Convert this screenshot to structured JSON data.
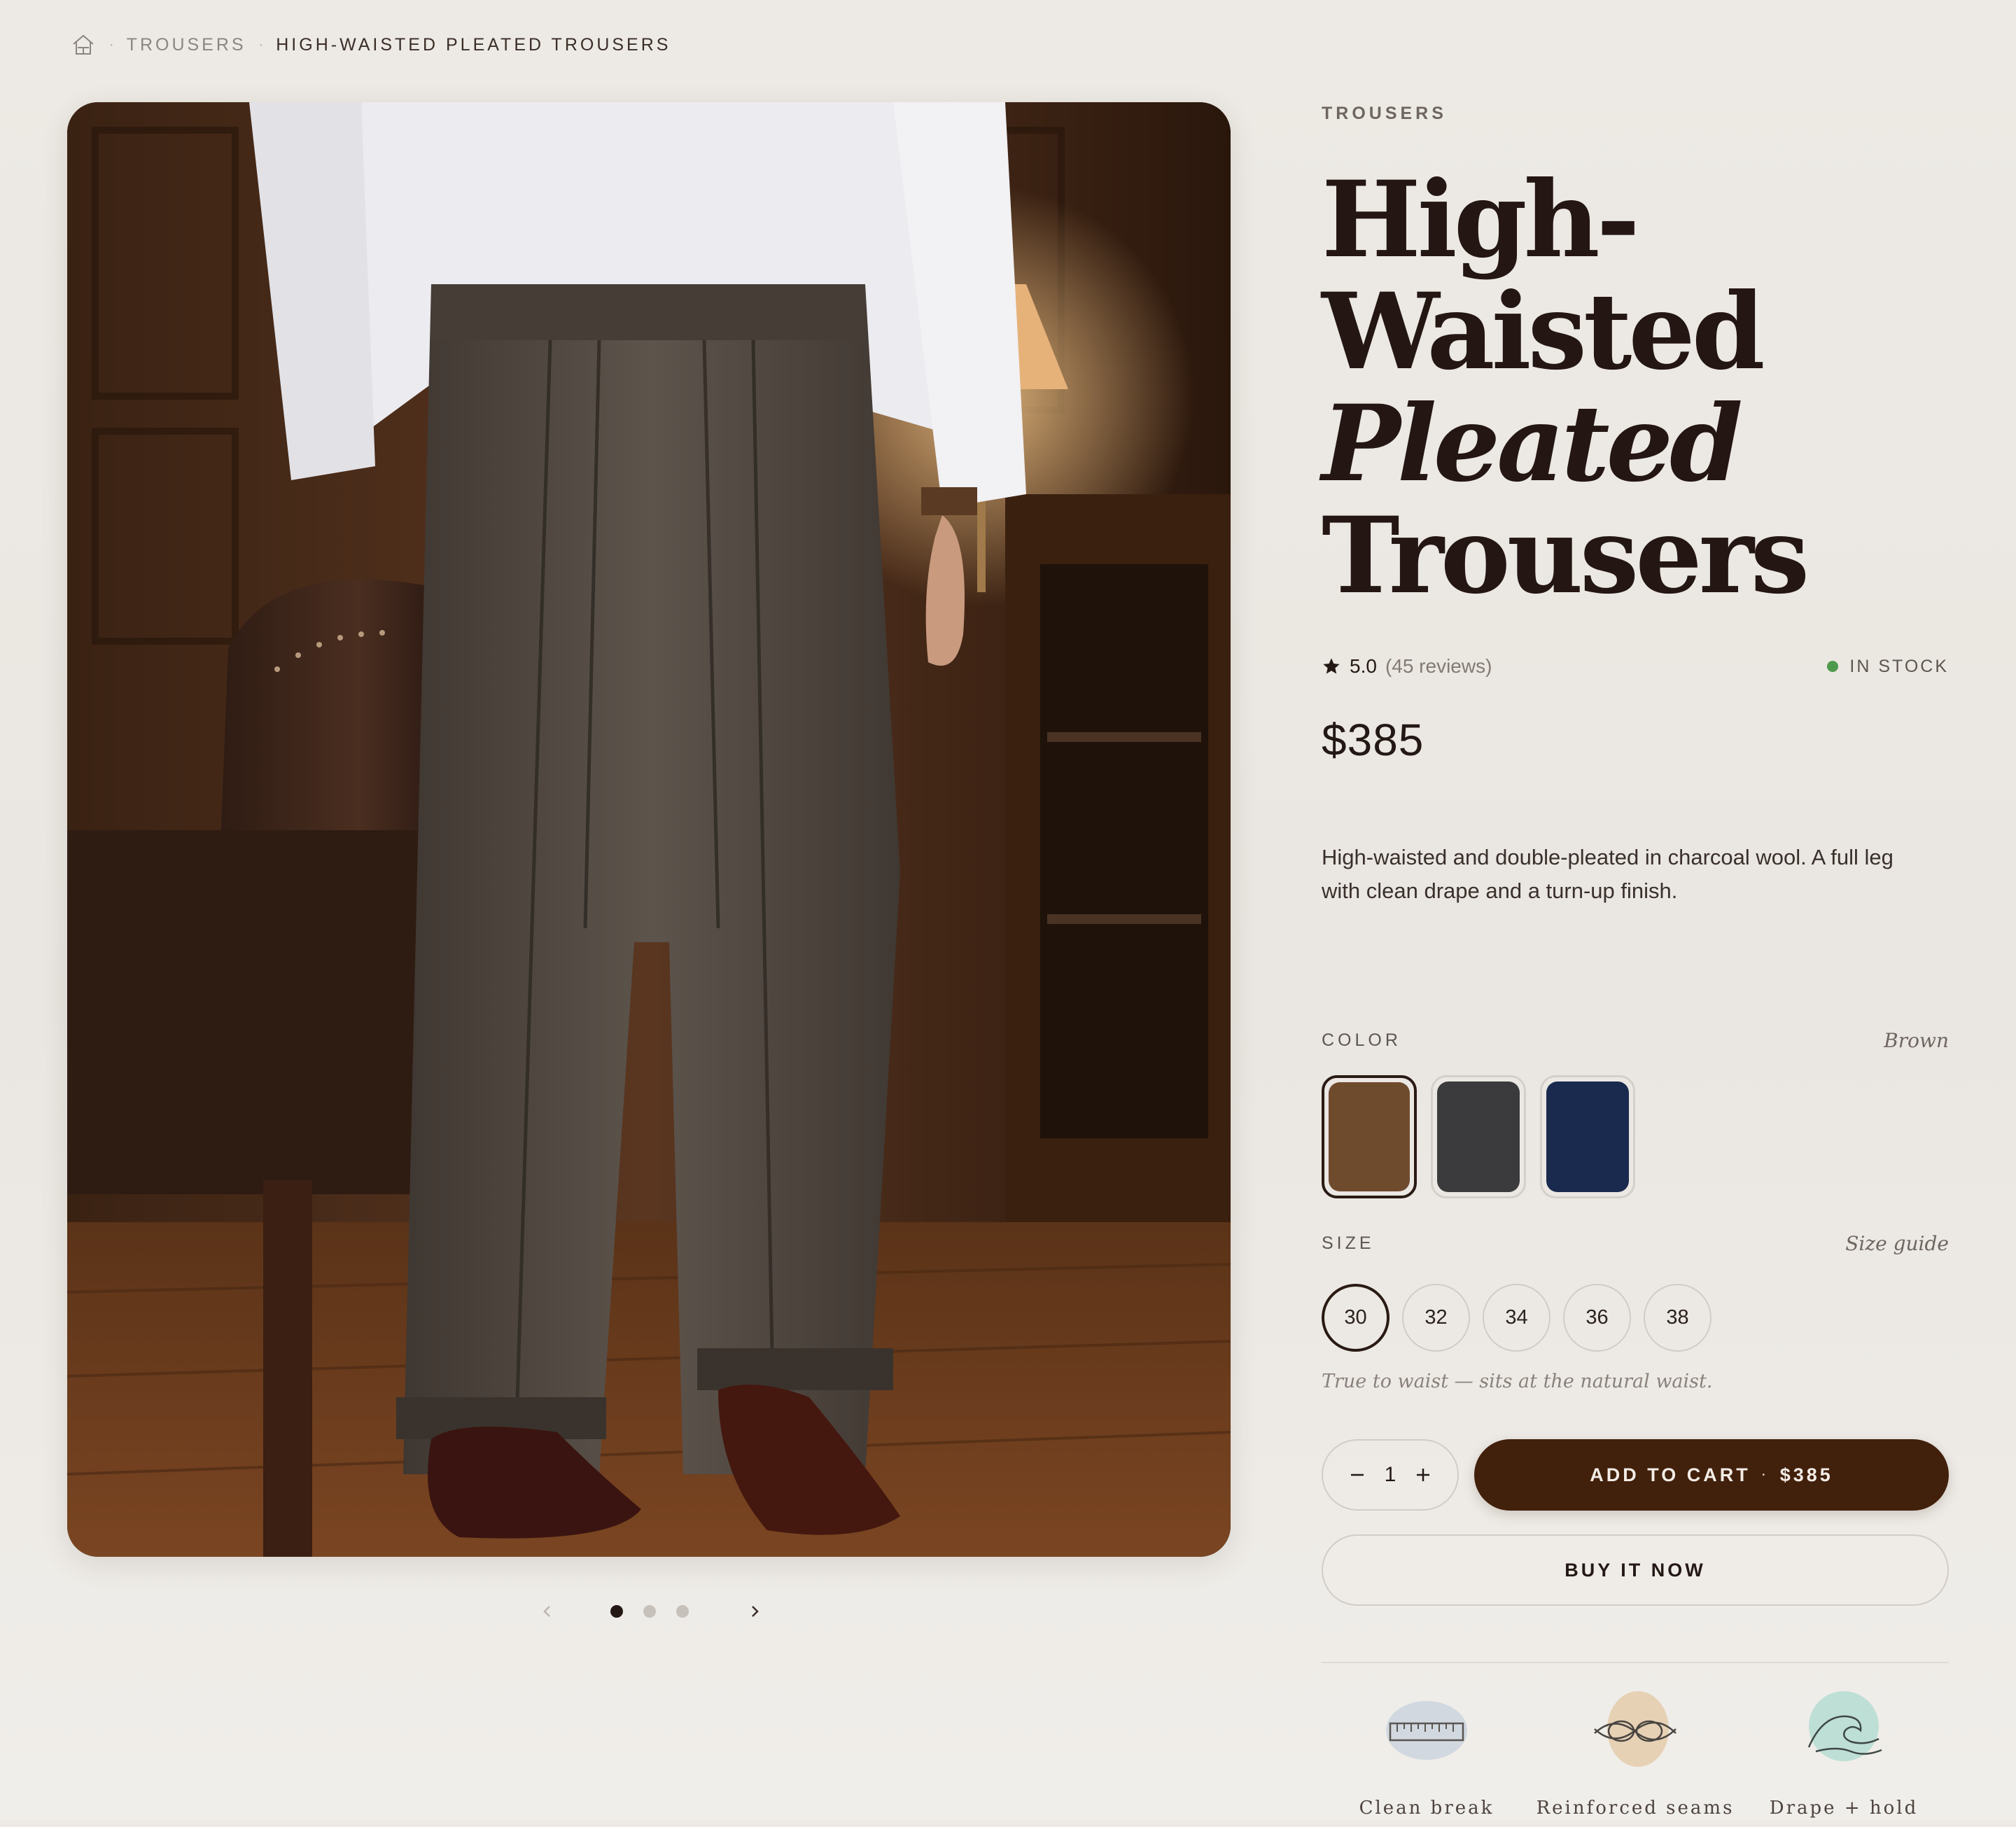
{
  "breadcrumb": {
    "home_icon": "home-icon",
    "separator": "·",
    "category": "TROUSERS",
    "current": "HIGH-WAISTED PLEATED TROUSERS"
  },
  "gallery": {
    "image_alt": "Man wearing high-waisted pleated brown herringbone trousers in a wood-panelled study",
    "slide_count": 3,
    "active_slide": 1,
    "prev_icon": "chevron-left-icon",
    "next_icon": "chevron-right-icon"
  },
  "product": {
    "category": "TROUSERS",
    "title_line1": "High-",
    "title_line2": "Waisted",
    "title_line3": "Pleated",
    "title_line4": "Trousers",
    "rating": "5.0",
    "reviews": "(45 reviews)",
    "stock": "IN STOCK",
    "price": "$385",
    "description": "High-waisted and double-pleated in charcoal wool. A full leg with clean drape and a turn-up finish."
  },
  "color": {
    "label": "COLOR",
    "selected_name": "Brown",
    "swatches": [
      {
        "name": "Brown",
        "hex": "#6f4b2e",
        "selected": true
      },
      {
        "name": "Charcoal",
        "hex": "#3b3b3d",
        "selected": false
      },
      {
        "name": "Navy",
        "hex": "#1a2a4e",
        "selected": false
      }
    ]
  },
  "size": {
    "label": "SIZE",
    "guide": "Size guide",
    "options": [
      "30",
      "32",
      "34",
      "36",
      "38"
    ],
    "selected": "30",
    "note": "True to waist — sits at the natural waist."
  },
  "purchase": {
    "quantity": "1",
    "add_to_cart": "ADD TO CART",
    "add_separator": "·",
    "add_price": "$385",
    "buy_now": "BUY IT NOW"
  },
  "features": [
    {
      "icon": "tape-measure-icon",
      "label": "Clean break"
    },
    {
      "icon": "knot-icon",
      "label": "Reinforced seams"
    },
    {
      "icon": "wave-icon",
      "label": "Drape + hold"
    }
  ],
  "colors": {
    "accent": "#41200c",
    "text": "#231814",
    "muted": "#8c8580",
    "in_stock": "#4e9a4c",
    "background": "#edeae5"
  }
}
